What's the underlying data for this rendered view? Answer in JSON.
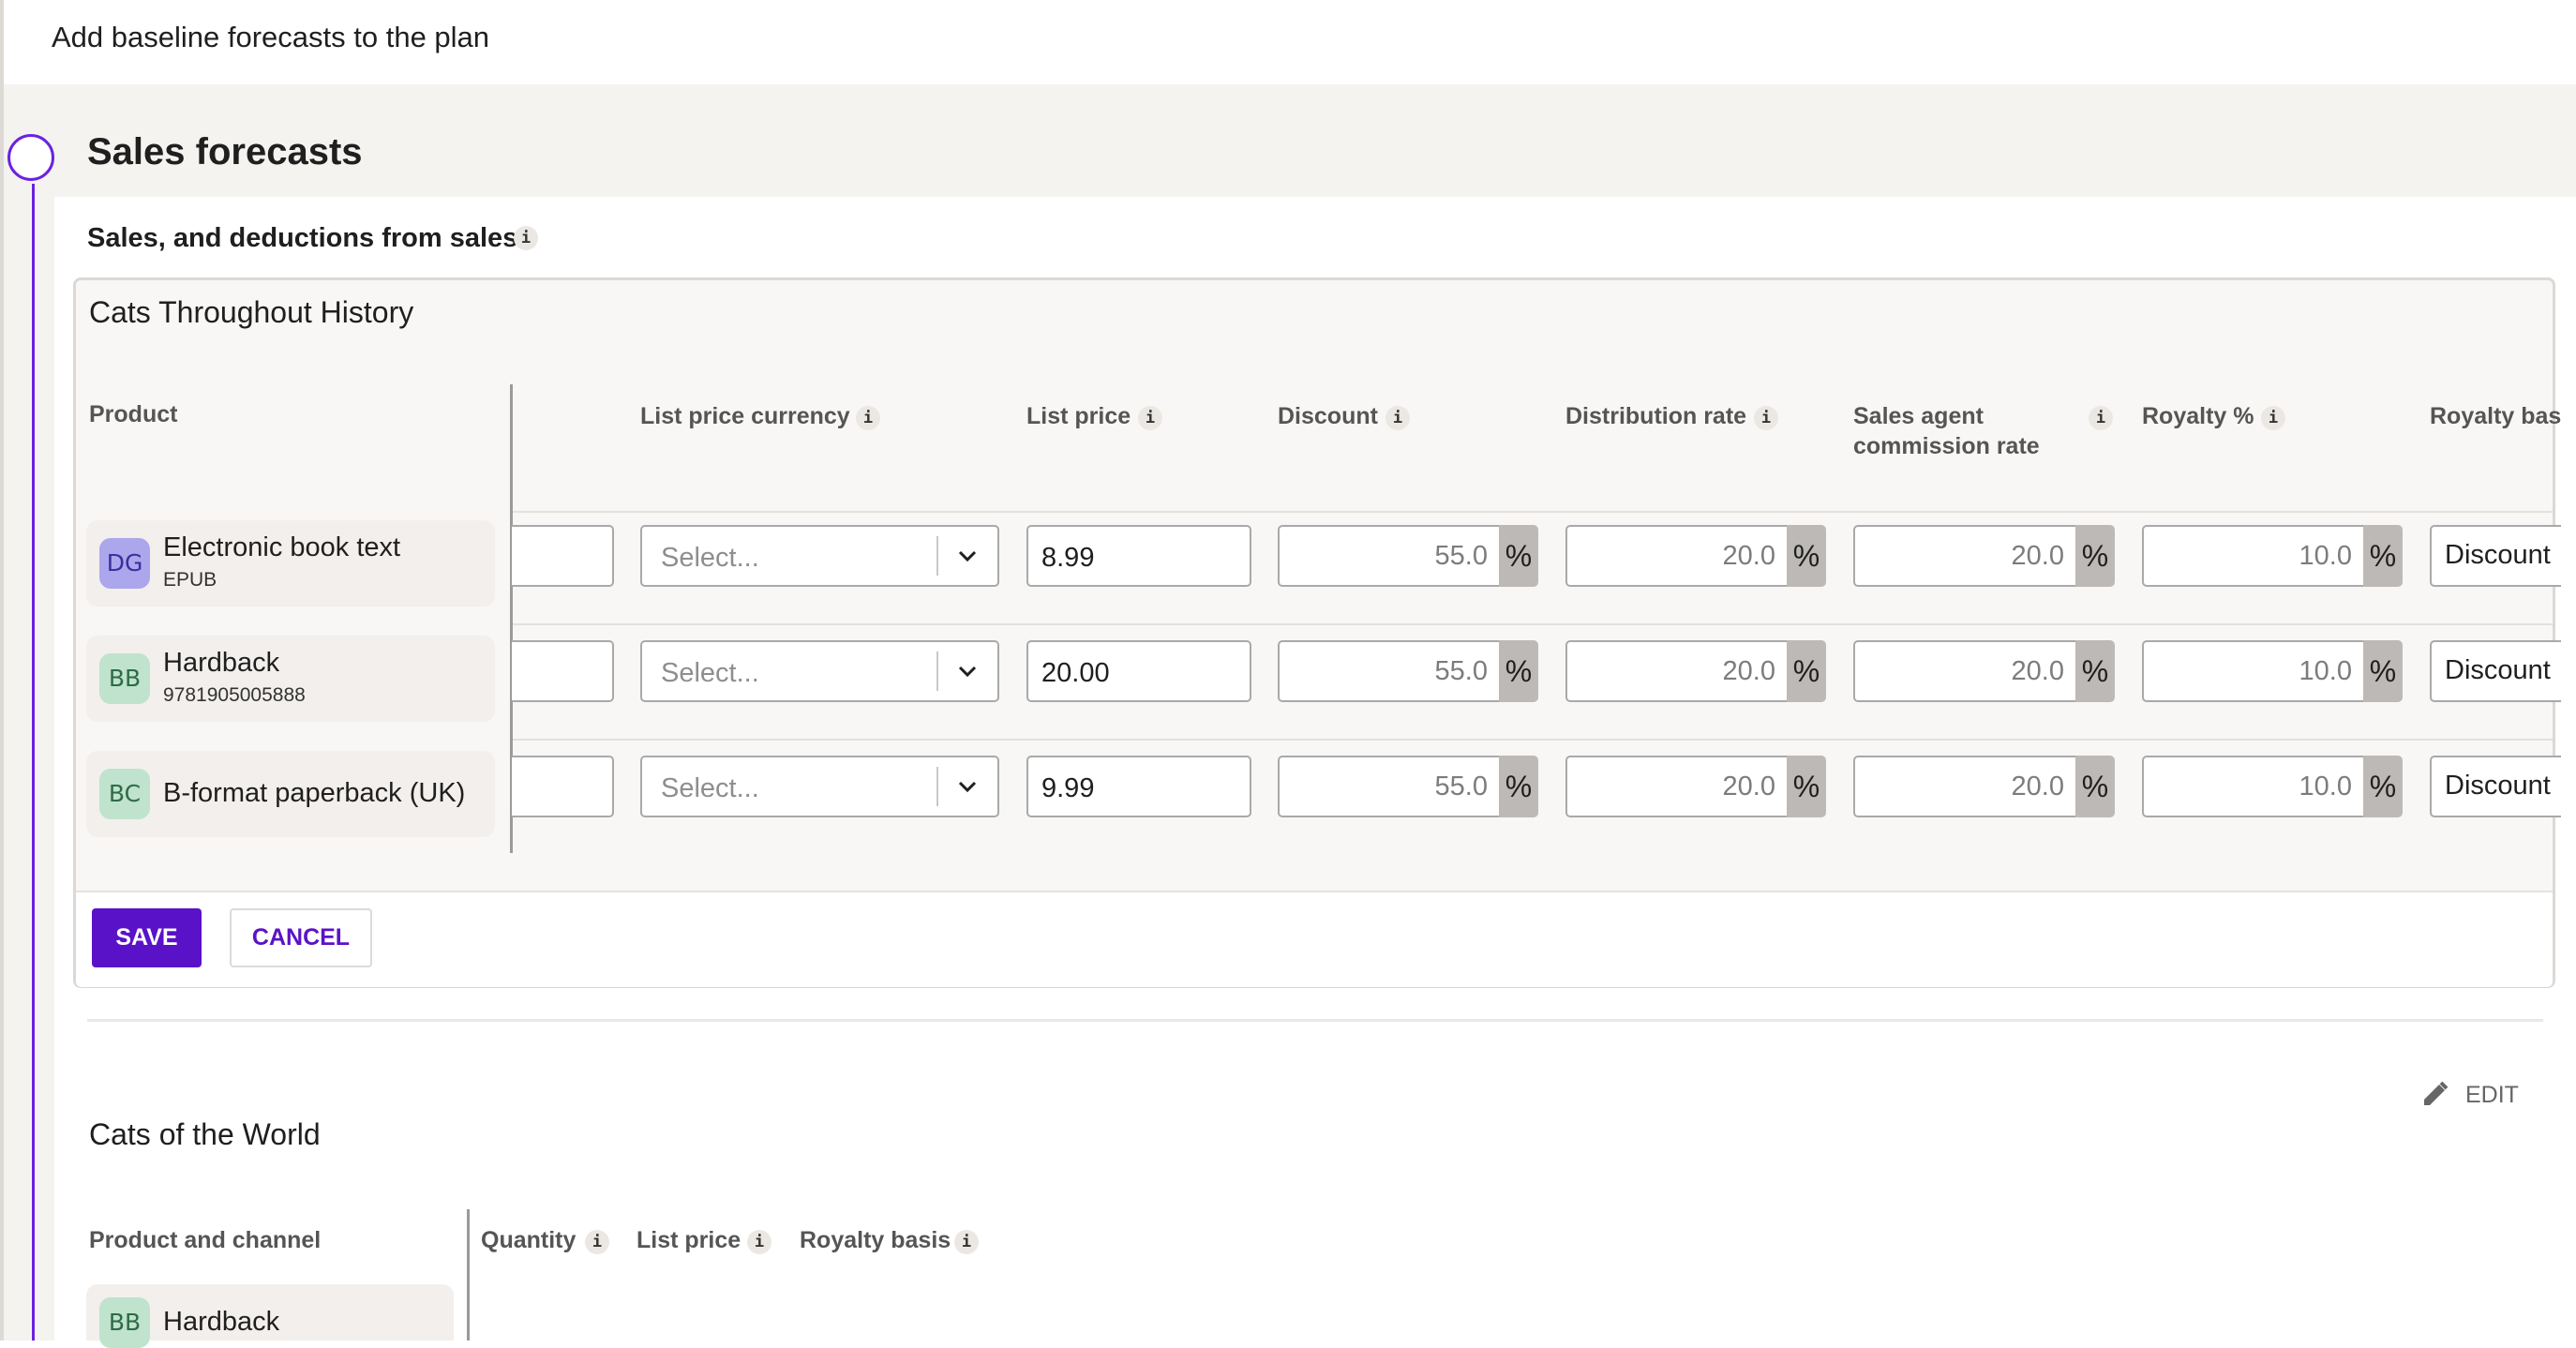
{
  "header": {
    "title": "Add baseline forecasts to the plan"
  },
  "section": {
    "title": "Sales forecasts",
    "subtitle": "Sales, and deductions from sales"
  },
  "card1": {
    "title": "Cats Throughout History",
    "columns": {
      "product": "Product",
      "list_price_currency": "List price currency",
      "list_price": "List price",
      "discount": "Discount",
      "distribution_rate": "Distribution rate",
      "sales_agent_line1": "Sales agent",
      "sales_agent_line2": "commission rate",
      "royalty_pct": "Royalty %",
      "royalty_basis": "Royalty bas"
    },
    "select_placeholder": "Select...",
    "percent_unit": "%",
    "rows": [
      {
        "initials": "DG",
        "name": "Electronic book text",
        "sub": "EPUB",
        "list_price": "8.99",
        "discount": "55.0",
        "distribution": "20.0",
        "agent": "20.0",
        "royalty": "10.0",
        "basis": "Discount"
      },
      {
        "initials": "BB",
        "name": "Hardback",
        "sub": "9781905005888",
        "list_price": "20.00",
        "discount": "55.0",
        "distribution": "20.0",
        "agent": "20.0",
        "royalty": "10.0",
        "basis": "Discount"
      },
      {
        "initials": "BC",
        "name": "B-format paperback (UK)",
        "sub": "",
        "list_price": "9.99",
        "discount": "55.0",
        "distribution": "20.0",
        "agent": "20.0",
        "royalty": "10.0",
        "basis": "Discount"
      }
    ],
    "save_label": "SAVE",
    "cancel_label": "CANCEL"
  },
  "card2": {
    "title": "Cats of the World",
    "edit_label": "EDIT",
    "columns": {
      "product_channel": "Product and channel",
      "quantity": "Quantity",
      "list_price": "List price",
      "royalty_basis": "Royalty basis"
    },
    "rows": [
      {
        "initials": "BB",
        "name": "Hardback"
      }
    ]
  },
  "info_glyph": "i",
  "colors": {
    "accent": "#5a12c8",
    "timeline": "#6c22e0",
    "section_bg": "#f5f3f0",
    "avatar_dg_bg": "#aca6ec",
    "avatar_dg_fg": "#3a2f9e",
    "avatar_green_bg": "#bfe3cd",
    "avatar_green_fg": "#2f6b45"
  }
}
